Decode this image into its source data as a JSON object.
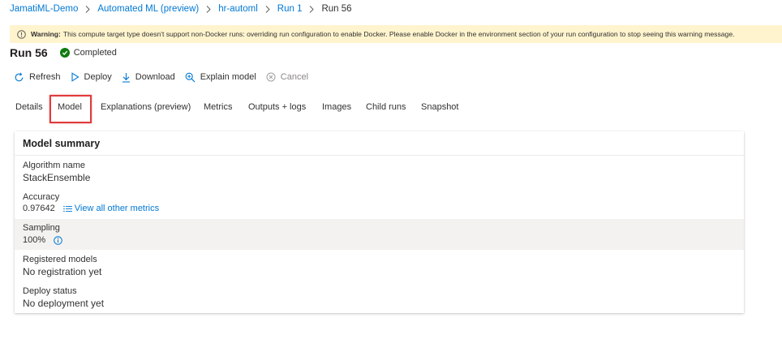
{
  "breadcrumb": {
    "items": [
      "JamatiML-Demo",
      "Automated ML (preview)",
      "hr-automl",
      "Run 1"
    ],
    "current": "Run 56"
  },
  "warning": {
    "prefix": "Warning:",
    "message": "This compute target type doesn't support non-Docker runs: overriding run configuration to enable Docker. Please enable Docker in the environment section of your run configuration to stop seeing this warning message."
  },
  "run": {
    "title": "Run 56",
    "status": "Completed",
    "status_color": "#107c10"
  },
  "toolbar": {
    "refresh": "Refresh",
    "deploy": "Deploy",
    "download": "Download",
    "explain": "Explain model",
    "cancel": "Cancel"
  },
  "tabs": [
    "Details",
    "Model",
    "Explanations (preview)",
    "Metrics",
    "Outputs + logs",
    "Images",
    "Child runs",
    "Snapshot"
  ],
  "selected_tab": "Model",
  "model_summary": {
    "title": "Model summary",
    "algorithm_label": "Algorithm name",
    "algorithm_value": "StackEnsemble",
    "accuracy_label": "Accuracy",
    "accuracy_value": "0.97642",
    "view_metrics": "View all other metrics",
    "sampling_label": "Sampling",
    "sampling_value": "100%",
    "registered_label": "Registered models",
    "registered_value": "No registration yet",
    "deploy_label": "Deploy status",
    "deploy_value": "No deployment yet"
  },
  "colors": {
    "link": "#0078d4",
    "warning_bg": "#fff4ce",
    "highlight": "#e03c3c"
  }
}
